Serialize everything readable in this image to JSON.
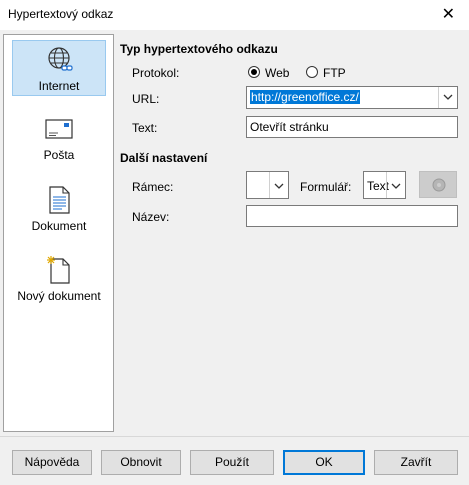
{
  "window": {
    "title": "Hypertextový odkaz",
    "close_glyph": "✕"
  },
  "sidebar": {
    "items": [
      {
        "label": "Internet",
        "icon": "globe-icon",
        "selected": true
      },
      {
        "label": "Pošta",
        "icon": "envelope-icon",
        "selected": false
      },
      {
        "label": "Dokument",
        "icon": "document-icon",
        "selected": false
      },
      {
        "label": "Nový dokument",
        "icon": "new-document-icon",
        "selected": false
      }
    ]
  },
  "hyperlink_type": {
    "heading": "Typ hypertextového odkazu",
    "protocol_label": "Protokol:",
    "web_label": "Web",
    "ftp_label": "FTP",
    "selected": "Web",
    "url_label": "URL:",
    "url_value": "http://greenoffice.cz/",
    "text_label": "Text:",
    "text_value": "Otevřít stránku"
  },
  "other_settings": {
    "heading": "Další nastavení",
    "frame_label": "Rámec:",
    "frame_value": "",
    "form_label": "Formulář:",
    "form_value": "Text",
    "name_label": "Název:",
    "name_value": ""
  },
  "buttons": {
    "help": "Nápověda",
    "reset": "Obnovit",
    "apply": "Použít",
    "ok": "OK",
    "close": "Zavřít"
  },
  "colors": {
    "selection": "#0078d7",
    "sidebar_selected": "#cce4f7"
  }
}
